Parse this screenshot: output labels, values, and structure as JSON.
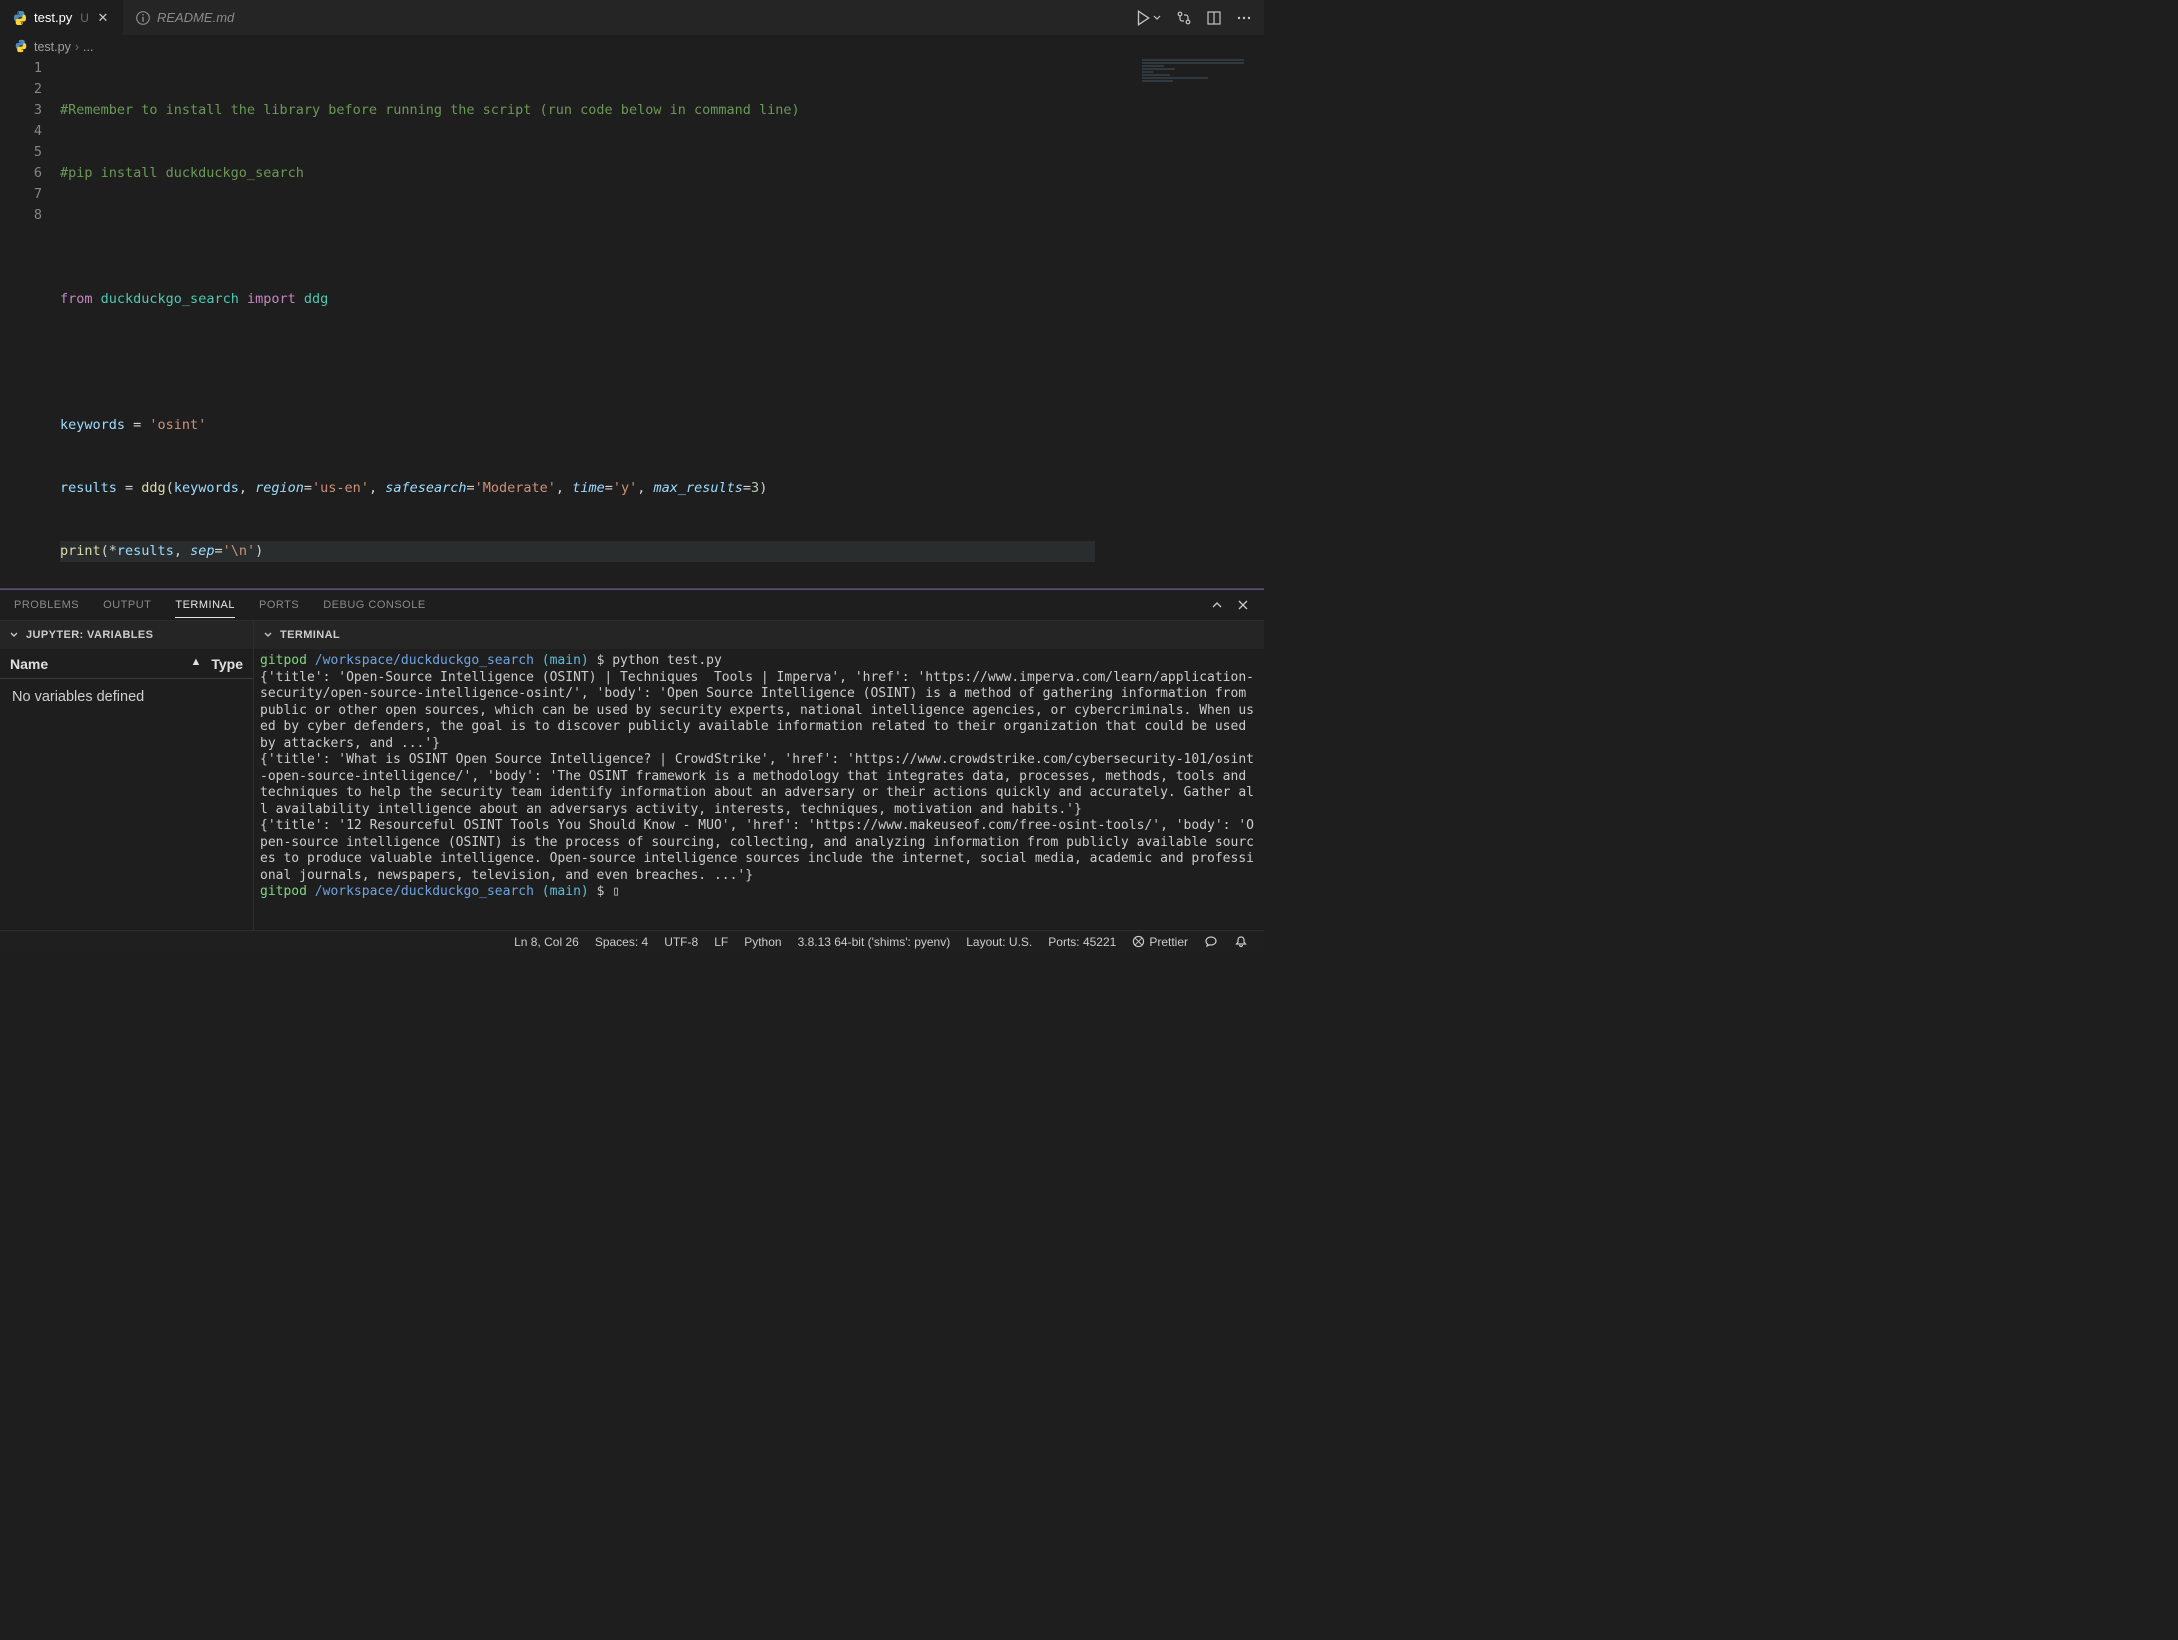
{
  "tabs": {
    "active": {
      "name": "test.py",
      "modified": "U"
    },
    "inactive": {
      "name": "README.md"
    }
  },
  "breadcrumb": {
    "file": "test.py",
    "sep": "›",
    "more": "..."
  },
  "code": {
    "lines": [
      "1",
      "2",
      "3",
      "4",
      "5",
      "6",
      "7",
      "8"
    ],
    "l1": "#Remember to install the library before running the script (run code below in command line)",
    "l2": "#pip install duckduckgo_search",
    "l4_from": "from",
    "l4_mod": "duckduckgo_search",
    "l4_import": "import",
    "l4_sym": "ddg",
    "l6_var": "keywords",
    "l6_eq": " = ",
    "l6_val": "'osint'",
    "l7_var": "results",
    "l7_eq": " = ",
    "l7_fn": "ddg",
    "l7_open": "(",
    "l7_a1": "keywords",
    "l7_c1": ", ",
    "l7_k1": "region",
    "l7_e1": "=",
    "l7_v1": "'us-en'",
    "l7_c2": ", ",
    "l7_k2": "safesearch",
    "l7_e2": "=",
    "l7_v2": "'Moderate'",
    "l7_c3": ", ",
    "l7_k3": "time",
    "l7_e3": "=",
    "l7_v3": "'y'",
    "l7_c4": ", ",
    "l7_k4": "max_results",
    "l7_e4": "=",
    "l7_v4": "3",
    "l7_close": ")",
    "l8_fn": "print",
    "l8_open": "(",
    "l8_star": "*",
    "l8_a1": "results",
    "l8_c1": ", ",
    "l8_k1": "sep",
    "l8_e1": "=",
    "l8_v1": "'\\n'",
    "l8_close": ")"
  },
  "panel_tabs": {
    "problems": "PROBLEMS",
    "output": "OUTPUT",
    "terminal": "TERMINAL",
    "ports": "PORTS",
    "debug": "DEBUG CONSOLE"
  },
  "jupyter": {
    "header": "JUPYTER: VARIABLES",
    "col1": "Name",
    "col2": "Type",
    "empty": "No variables defined"
  },
  "terminal_header": "TERMINAL",
  "terminal": {
    "prompt_user": "gitpod",
    "prompt_path": "/workspace/duckduckgo_search",
    "prompt_branch": "(main)",
    "prompt_symbol": "$",
    "cmd": "python test.py",
    "out1": "{'title': 'Open-Source Intelligence (OSINT) | Techniques  Tools | Imperva', 'href': 'https://www.imperva.com/learn/application-security/open-source-intelligence-osint/', 'body': 'Open Source Intelligence (OSINT) is a method of gathering information from public or other open sources, which can be used by security experts, national intelligence agencies, or cybercriminals. When used by cyber defenders, the goal is to discover publicly available information related to their organization that could be used by attackers, and ...'}",
    "out2": "{'title': 'What is OSINT Open Source Intelligence? | CrowdStrike', 'href': 'https://www.crowdstrike.com/cybersecurity-101/osint-open-source-intelligence/', 'body': 'The OSINT framework is a methodology that integrates data, processes, methods, tools and techniques to help the security team identify information about an adversary or their actions quickly and accurately. Gather all availability intelligence about an adversarys activity, interests, techniques, motivation and habits.'}",
    "out3": "{'title': '12 Resourceful OSINT Tools You Should Know - MUO', 'href': 'https://www.makeuseof.com/free-osint-tools/', 'body': 'Open-source intelligence (OSINT) is the process of sourcing, collecting, and analyzing information from publicly available sources to produce valuable intelligence. Open-source intelligence sources include the internet, social media, academic and professional journals, newspapers, television, and even breaches. ...'}",
    "cursor": "▯"
  },
  "statusbar": {
    "ln": "Ln 8, Col 26",
    "spaces": "Spaces: 4",
    "enc": "UTF-8",
    "eol": "LF",
    "lang": "Python",
    "py": "3.8.13 64-bit ('shims': pyenv)",
    "layout": "Layout: U.S.",
    "ports": "Ports: 45221",
    "prettier": "Prettier"
  }
}
